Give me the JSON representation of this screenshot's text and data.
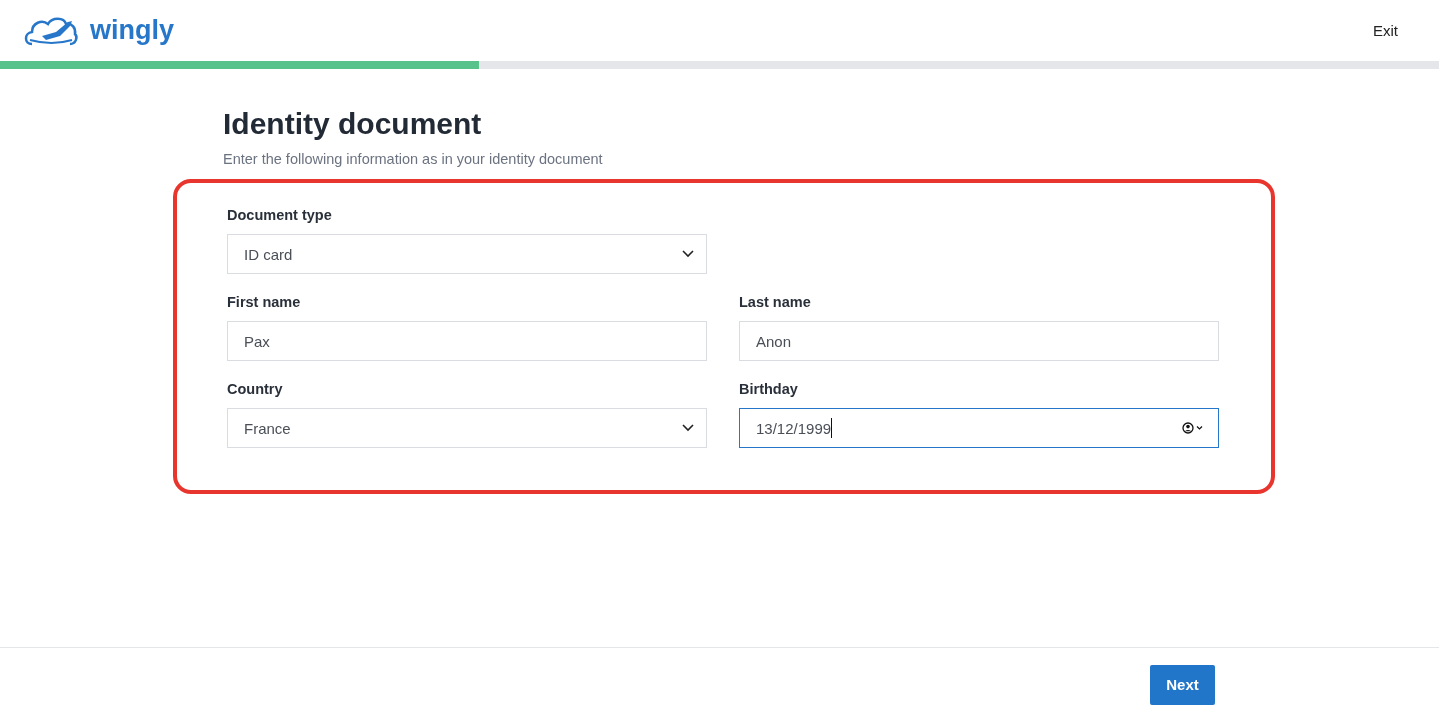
{
  "header": {
    "logo_text": "wingly",
    "exit": "Exit"
  },
  "progress": {
    "level": 0.333
  },
  "page": {
    "title": "Identity document",
    "subtitle": "Enter the following information as in your identity document"
  },
  "form": {
    "highlighted": true,
    "rows": [
      {
        "fields": [
          {
            "kind": "select",
            "label": "Document type",
            "value": "ID card",
            "focused": false
          }
        ]
      },
      {
        "fields": [
          {
            "kind": "text",
            "label": "First name",
            "value": "Pax",
            "focused": false
          },
          {
            "kind": "text",
            "label": "Last name",
            "value": "Anon",
            "focused": false
          }
        ]
      },
      {
        "fields": [
          {
            "kind": "select",
            "label": "Country",
            "value": "France",
            "focused": false
          },
          {
            "kind": "date",
            "label": "Birthday",
            "value": "13/12/1999",
            "focused": true
          }
        ]
      }
    ]
  },
  "footer": {
    "next": "Next"
  }
}
